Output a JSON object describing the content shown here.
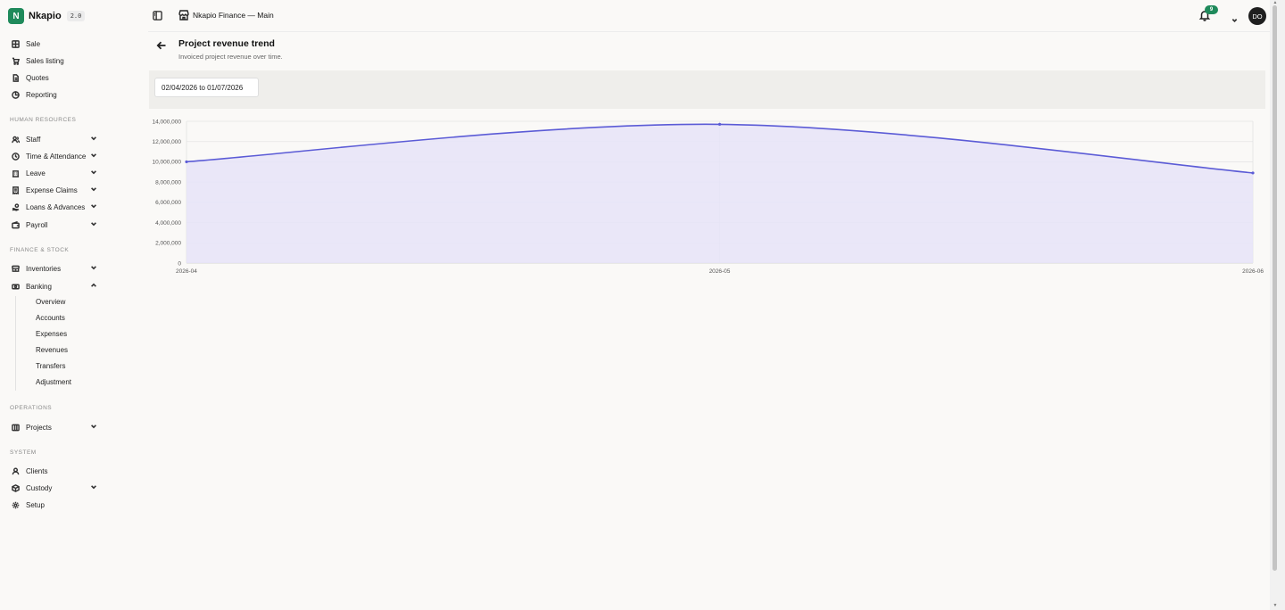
{
  "brand": {
    "logo_letter": "N",
    "name": "Nkapio",
    "version": "2.0"
  },
  "header": {
    "org_title": "Nkapio Finance — Main",
    "notification_count": "9",
    "avatar_initials": "DO"
  },
  "sidebar": {
    "top_items": [
      {
        "label": "Sale",
        "icon": "grid-icon"
      },
      {
        "label": "Sales listing",
        "icon": "cart-icon"
      },
      {
        "label": "Quotes",
        "icon": "document-icon"
      },
      {
        "label": "Reporting",
        "icon": "chart-pie-icon"
      }
    ],
    "sections": {
      "human_resources": "HUMAN RESOURCES",
      "finance_stock": "FINANCE & STOCK",
      "operations": "OPERATIONS",
      "system": "SYSTEM"
    },
    "hr_items": [
      {
        "label": "Staff",
        "icon": "users-icon"
      },
      {
        "label": "Time & Attendance",
        "icon": "clock-icon"
      },
      {
        "label": "Leave",
        "icon": "building-icon"
      },
      {
        "label": "Expense Claims",
        "icon": "receipt-icon"
      },
      {
        "label": "Loans & Advances",
        "icon": "hand-coins-icon"
      },
      {
        "label": "Payroll",
        "icon": "wallet-icon"
      }
    ],
    "finance_items": [
      {
        "label": "Inventories",
        "icon": "stack-icon"
      },
      {
        "label": "Banking",
        "icon": "banknote-icon"
      }
    ],
    "banking_subitems": [
      "Overview",
      "Accounts",
      "Expenses",
      "Revenues",
      "Transfers",
      "Adjustment"
    ],
    "operations_items": [
      {
        "label": "Projects",
        "icon": "columns-icon"
      }
    ],
    "system_items": [
      {
        "label": "Clients",
        "icon": "user-icon"
      },
      {
        "label": "Custody",
        "icon": "box-icon"
      },
      {
        "label": "Setup",
        "icon": "gear-icon"
      }
    ]
  },
  "page": {
    "title": "Project revenue trend",
    "subtitle": "Invoiced project revenue over time.",
    "date_range": "02/04/2026 to 01/07/2026"
  },
  "colors": {
    "accent": "#1f8a5b",
    "line": "#5b5bd6",
    "area": "#e6e4f8"
  },
  "chart_data": {
    "type": "area",
    "x": [
      "2026-04",
      "2026-05",
      "2026-06"
    ],
    "series": [
      {
        "values": [
          10000000,
          13700000,
          8900000
        ]
      }
    ],
    "ylim": [
      0,
      14000000
    ],
    "yticks": [
      0,
      2000000,
      4000000,
      6000000,
      8000000,
      10000000,
      12000000,
      14000000
    ],
    "ytick_labels": [
      "0",
      "2,000,000",
      "4,000,000",
      "6,000,000",
      "8,000,000",
      "10,000,000",
      "12,000,000",
      "14,000,000"
    ],
    "grid": true,
    "title": "",
    "xlabel": "",
    "ylabel": ""
  }
}
